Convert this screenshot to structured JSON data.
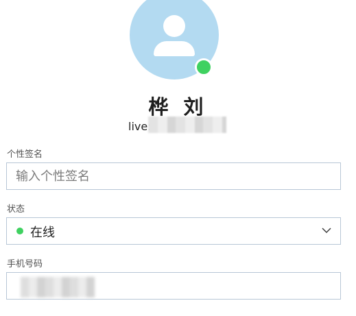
{
  "profile": {
    "name": "桦 刘",
    "live_prefix": "live:",
    "presence_color": "#3fd160",
    "avatar_color": "#b3daf1"
  },
  "fields": {
    "signature_label": "个性签名",
    "signature_placeholder": "输入个性签名",
    "status_label": "状态",
    "status_value": "在线",
    "phone_label": "手机号码"
  },
  "icons": {
    "avatar": "person-icon",
    "presence": "online-dot-icon",
    "dropdown": "chevron-down-icon"
  }
}
